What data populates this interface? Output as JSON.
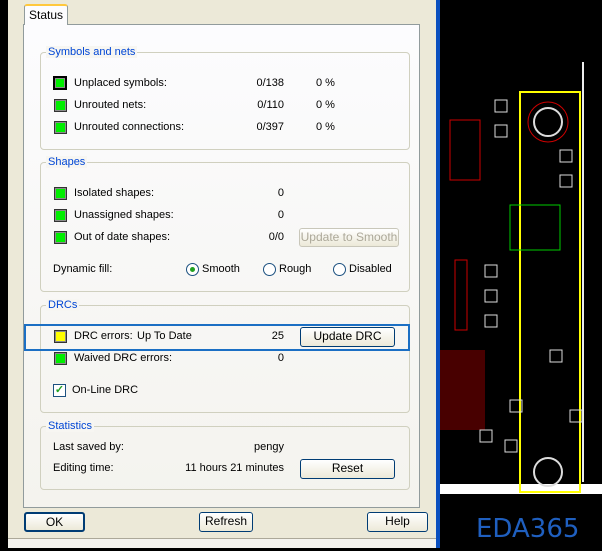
{
  "tab": "Status",
  "symbols": {
    "title": "Symbols and nets",
    "rows": [
      {
        "label": "Unplaced symbols:",
        "count": "0/138",
        "percent": "0 %",
        "status": "green"
      },
      {
        "label": "Unrouted nets:",
        "count": "0/110",
        "percent": "0 %",
        "status": "green"
      },
      {
        "label": "Unrouted connections:",
        "count": "0/397",
        "percent": "0 %",
        "status": "green"
      }
    ]
  },
  "shapes": {
    "title": "Shapes",
    "rows": [
      {
        "label": "Isolated shapes:",
        "count": "0"
      },
      {
        "label": "Unassigned shapes:",
        "count": "0"
      },
      {
        "label": "Out of date shapes:",
        "count": "0/0"
      }
    ],
    "update_button": "Update to Smooth",
    "dynamic_fill_label": "Dynamic fill:",
    "fill_options": [
      "Smooth",
      "Rough",
      "Disabled"
    ],
    "fill_selected": "Smooth"
  },
  "drcs": {
    "title": "DRCs",
    "errors_label": "DRC errors:",
    "errors_state": "Up To Date",
    "errors_count": "25",
    "update_button": "Update DRC",
    "waived_label": "Waived DRC errors:",
    "waived_count": "0",
    "online_label": "On-Line DRC",
    "online_checked": true
  },
  "statistics": {
    "title": "Statistics",
    "saved_by_label": "Last saved by:",
    "saved_by": "pengy",
    "editing_label": "Editing time:",
    "editing_time": "11 hours 21 minutes",
    "reset_button": "Reset"
  },
  "footer": {
    "ok": "OK",
    "refresh": "Refresh",
    "help": "Help"
  },
  "watermark": "EDA365",
  "colors": {
    "ok": "#00ee00",
    "warn": "#ffff00",
    "accent": "#0046d5"
  }
}
